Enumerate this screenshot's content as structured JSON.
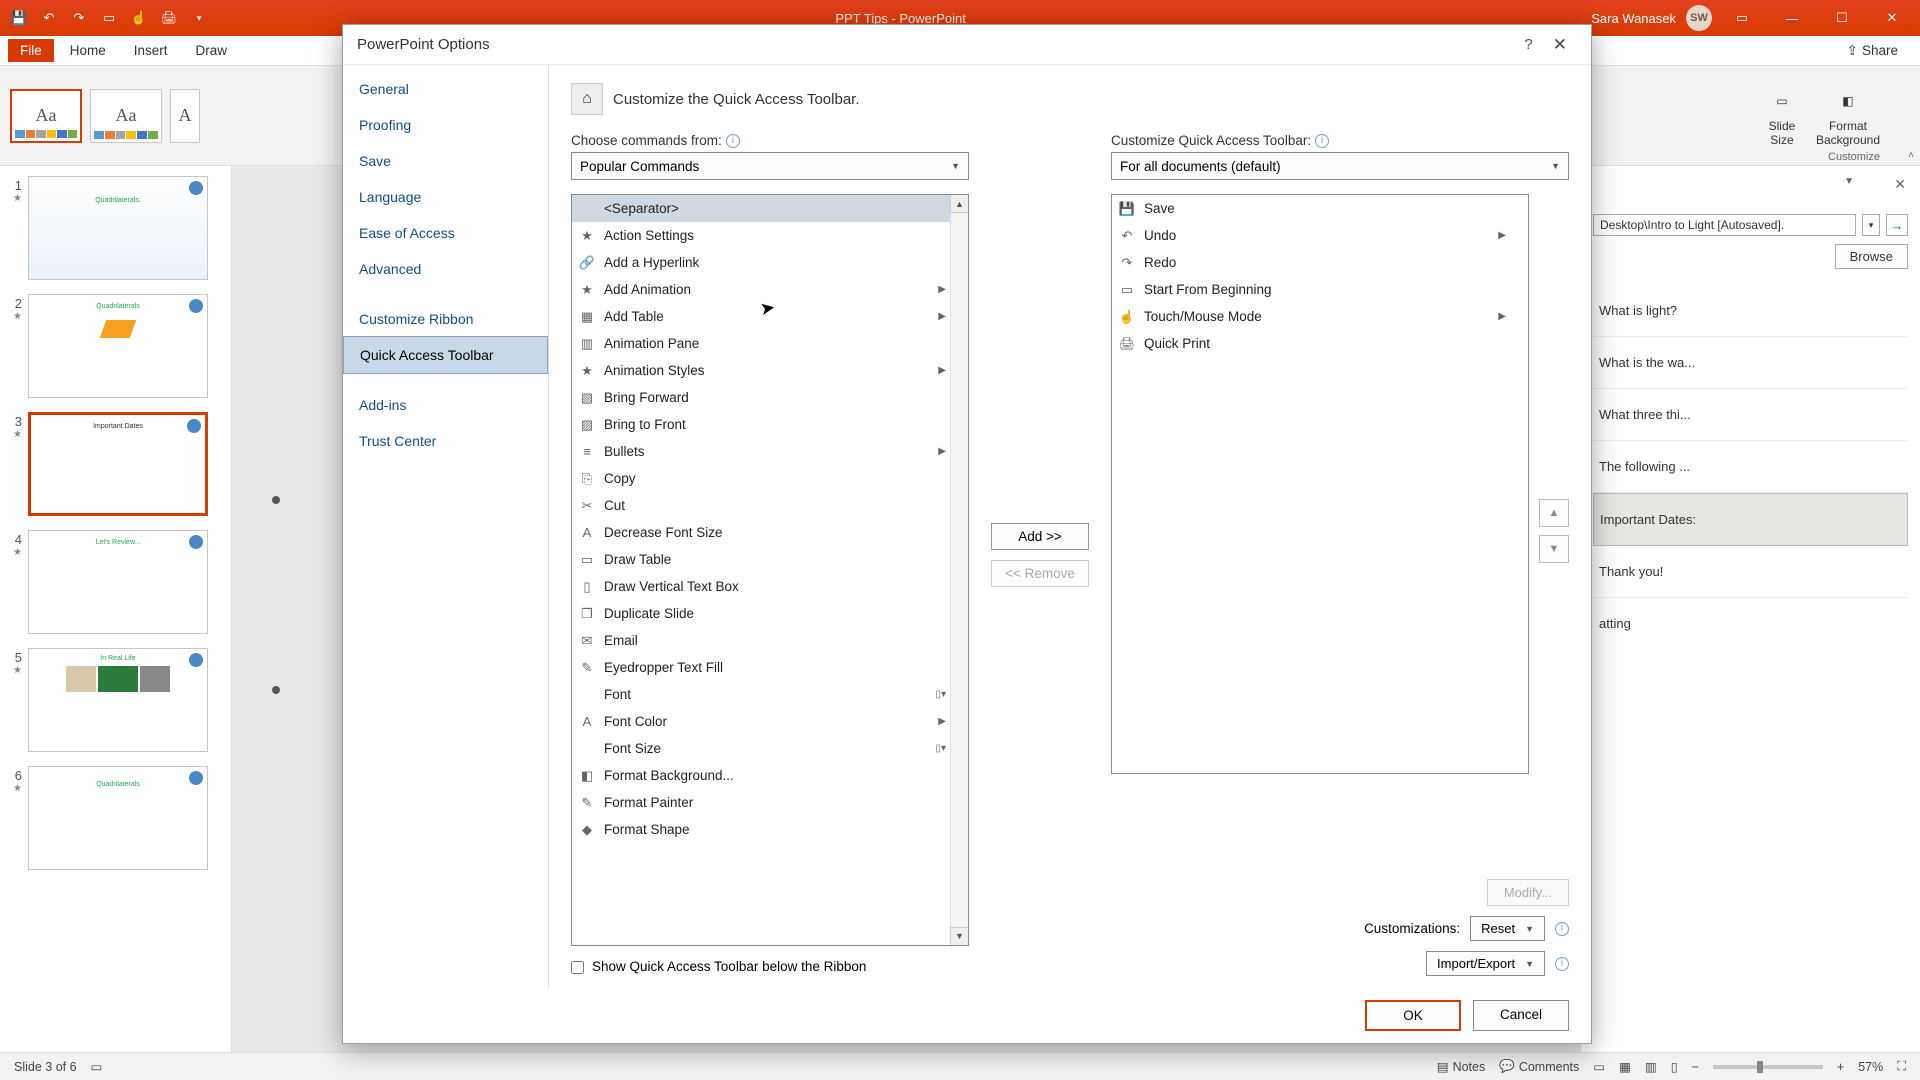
{
  "title": "PPT Tips - PowerPoint",
  "user": {
    "name": "Sara Wanasek",
    "initials": "SW"
  },
  "ribbon_tabs": {
    "file": "File",
    "home": "Home",
    "insert": "Insert",
    "draw": "Draw",
    "share": "Share"
  },
  "ribbon_right": {
    "slide_size": "Slide\nSize",
    "format_bg": "Format\nBackground",
    "group": "Customize"
  },
  "thumb_panel": {
    "nums": [
      "1",
      "2",
      "3",
      "4",
      "5",
      "6"
    ]
  },
  "side_panel": {
    "path": "Desktop\\Intro to Light [Autosaved].",
    "browse": "Browse",
    "rows": [
      "What is light?",
      "What is the wa...",
      "What three thi...",
      "The following ...",
      "Important Dates:",
      "Thank you!",
      "atting"
    ]
  },
  "statusbar": {
    "slide": "Slide 3 of 6",
    "notes": "Notes",
    "comments": "Comments",
    "zoom": "57%"
  },
  "dialog": {
    "title": "PowerPoint Options",
    "nav": [
      "General",
      "Proofing",
      "Save",
      "Language",
      "Ease of Access",
      "Advanced",
      "",
      "Customize Ribbon",
      "Quick Access Toolbar",
      "",
      "Add-ins",
      "Trust Center"
    ],
    "nav_selected": "Quick Access Toolbar",
    "heading": "Customize the Quick Access Toolbar.",
    "left_label": "Choose commands from:",
    "left_dd": "Popular Commands",
    "right_label": "Customize Quick Access Toolbar:",
    "right_dd": "For all documents (default)",
    "left_list": [
      {
        "label": "<Separator>",
        "icon": "",
        "sel": true
      },
      {
        "label": "Action Settings",
        "icon": "★"
      },
      {
        "label": "Add a Hyperlink",
        "icon": "🔗"
      },
      {
        "label": "Add Animation",
        "icon": "★",
        "sub": true
      },
      {
        "label": "Add Table",
        "icon": "▦",
        "sub": true
      },
      {
        "label": "Animation Pane",
        "icon": "▥"
      },
      {
        "label": "Animation Styles",
        "icon": "★",
        "sub": true
      },
      {
        "label": "Bring Forward",
        "icon": "▧"
      },
      {
        "label": "Bring to Front",
        "icon": "▨"
      },
      {
        "label": "Bullets",
        "icon": "≡",
        "sub": true
      },
      {
        "label": "Copy",
        "icon": "⎘"
      },
      {
        "label": "Cut",
        "icon": "✂"
      },
      {
        "label": "Decrease Font Size",
        "icon": "A"
      },
      {
        "label": "Draw Table",
        "icon": "▭"
      },
      {
        "label": "Draw Vertical Text Box",
        "icon": "▯"
      },
      {
        "label": "Duplicate Slide",
        "icon": "❐"
      },
      {
        "label": "Email",
        "icon": "✉"
      },
      {
        "label": "Eyedropper Text Fill",
        "icon": "✎"
      },
      {
        "label": "Font",
        "icon": "",
        "box": true
      },
      {
        "label": "Font Color",
        "icon": "A",
        "sub": true
      },
      {
        "label": "Font Size",
        "icon": "",
        "box": true
      },
      {
        "label": "Format Background...",
        "icon": "◧"
      },
      {
        "label": "Format Painter",
        "icon": "✎"
      },
      {
        "label": "Format Shape",
        "icon": "◆"
      }
    ],
    "right_list": [
      {
        "label": "Save",
        "icon": "💾"
      },
      {
        "label": "Undo",
        "icon": "↶",
        "sub": true
      },
      {
        "label": "Redo",
        "icon": "↷"
      },
      {
        "label": "Start From Beginning",
        "icon": "▭"
      },
      {
        "label": "Touch/Mouse Mode",
        "icon": "☝",
        "sub": true
      },
      {
        "label": "Quick Print",
        "icon": "🖨"
      }
    ],
    "add": "Add >>",
    "remove": "<< Remove",
    "modify": "Modify...",
    "show_below": "Show Quick Access Toolbar below the Ribbon",
    "customizations": "Customizations:",
    "reset": "Reset",
    "import_export": "Import/Export",
    "ok": "OK",
    "cancel": "Cancel"
  }
}
